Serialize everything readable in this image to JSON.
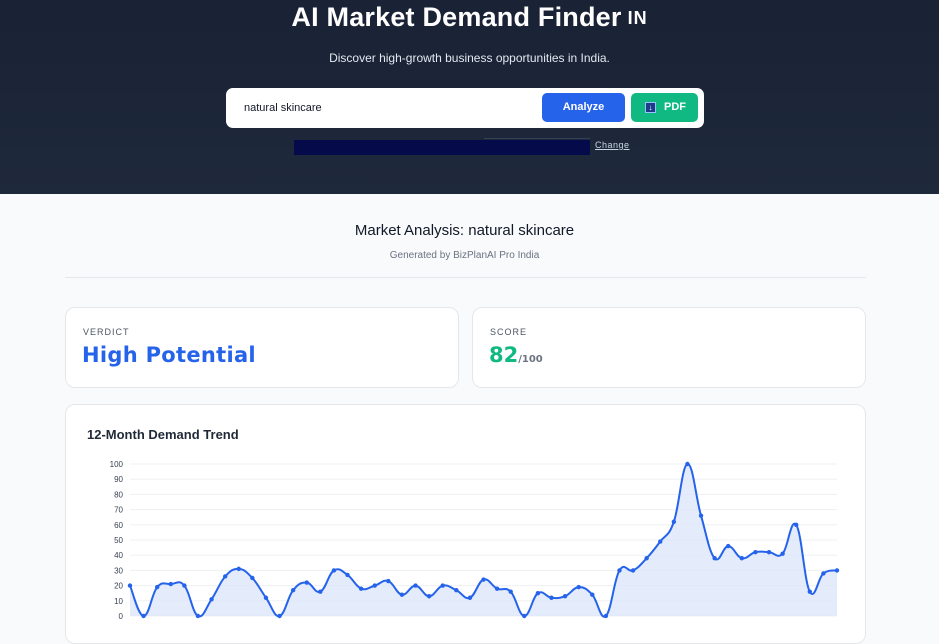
{
  "header": {
    "title": "AI Market Demand Finder",
    "flag": "IN",
    "subtitle": "Discover high-growth business opportunities in India."
  },
  "search": {
    "value": "natural skincare",
    "analyze_label": "Analyze",
    "pdf_label": "PDF",
    "change_label": "Change"
  },
  "analysis": {
    "title": "Market Analysis: natural skincare",
    "generated_by": "Generated by BizPlanAI Pro India"
  },
  "verdict": {
    "label": "VERDICT",
    "value": "High Potential"
  },
  "score": {
    "label": "SCORE",
    "value": "82",
    "max": "/100"
  },
  "colors": {
    "accent": "#2563eb",
    "success": "#10b981",
    "hero_bg": "#1e293b",
    "line": "#2563eb",
    "fill": "#dbe6fb"
  },
  "chart_data": {
    "type": "area",
    "title": "12-Month Demand Trend",
    "xlabel": "",
    "ylabel": "",
    "ylim": [
      0,
      100
    ],
    "yticks": [
      0,
      10,
      20,
      30,
      40,
      50,
      60,
      70,
      80,
      90,
      100
    ],
    "grid": true,
    "legend": "none",
    "series": [
      {
        "values": [
          20,
          0,
          19,
          21,
          20,
          0,
          11,
          26,
          31,
          25,
          12,
          0,
          17,
          22,
          16,
          30,
          27,
          18,
          20,
          23,
          14,
          20,
          13,
          20,
          17,
          12,
          24,
          18,
          16,
          0,
          15,
          12,
          13,
          19,
          14,
          0,
          30,
          30,
          38,
          49,
          62,
          100,
          66,
          38,
          46,
          38,
          42,
          42,
          41,
          60,
          16,
          28,
          30
        ]
      }
    ]
  }
}
